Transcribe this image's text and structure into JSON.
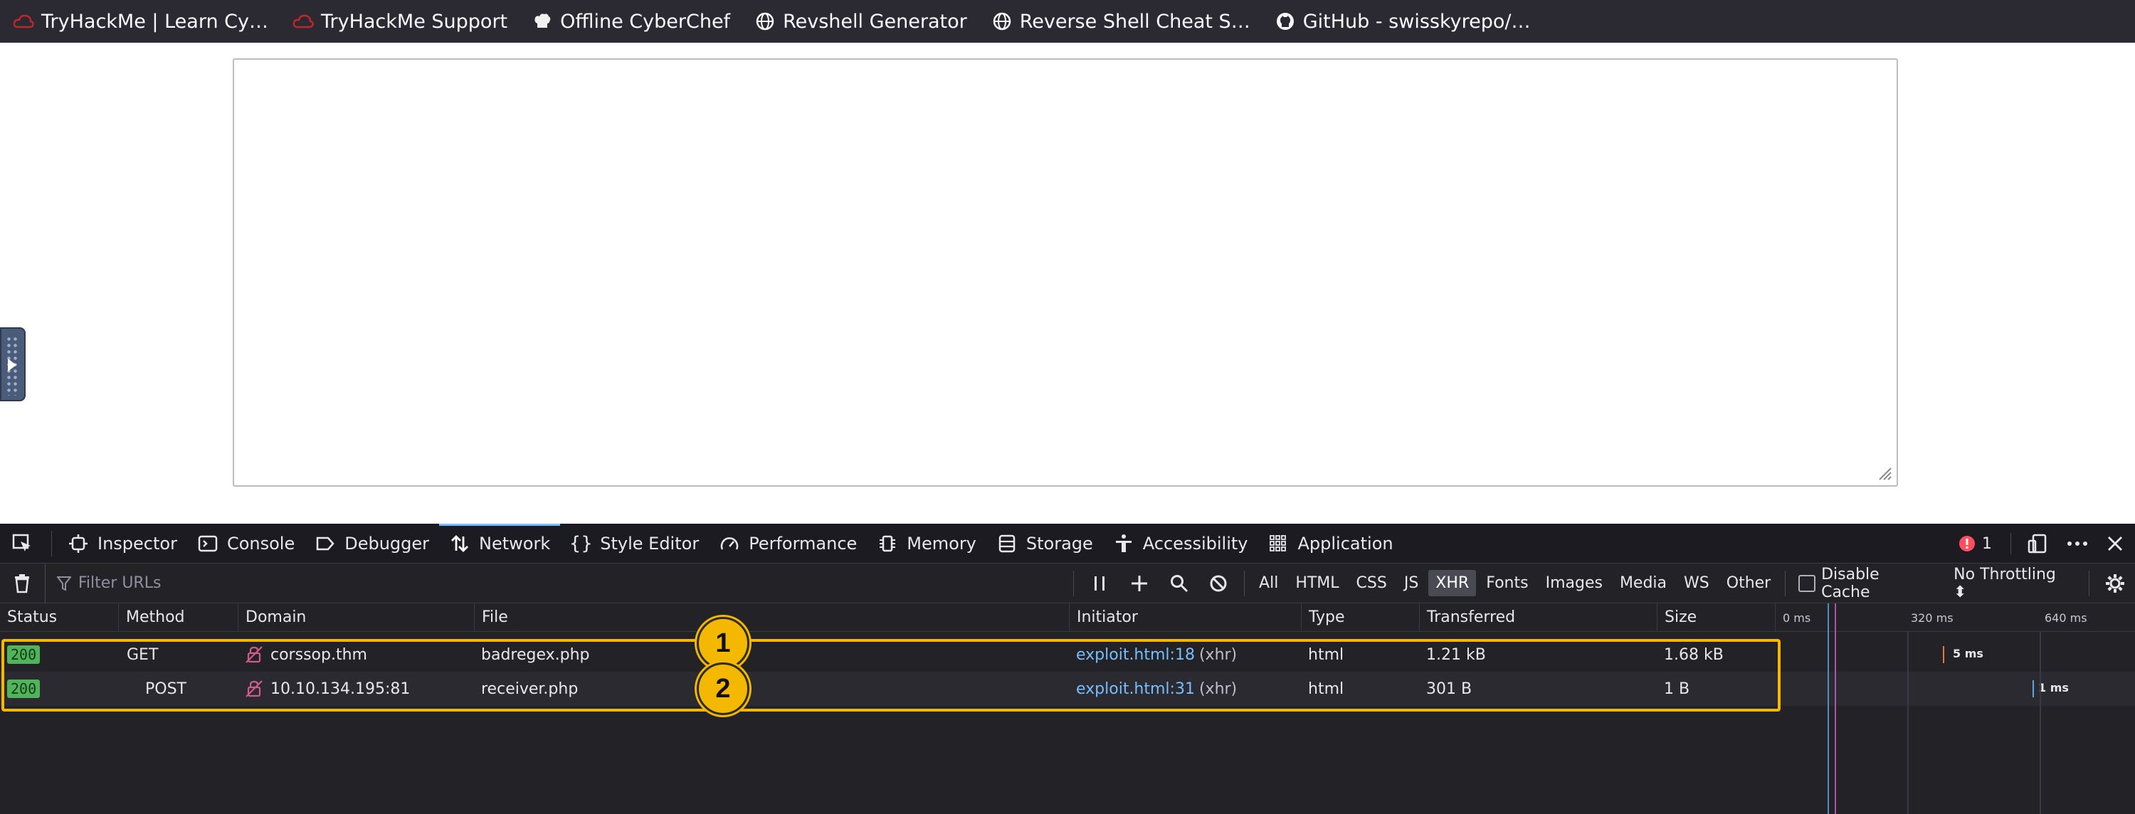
{
  "bookmarks": [
    {
      "label": "TryHackMe | Learn Cy…",
      "icon": "tryhackme-cloud-icon"
    },
    {
      "label": "TryHackMe Support",
      "icon": "tryhackme-cloud-icon"
    },
    {
      "label": "Offline CyberChef",
      "icon": "chef-hat-icon"
    },
    {
      "label": "Revshell Generator",
      "icon": "globe-icon"
    },
    {
      "label": "Reverse Shell Cheat S…",
      "icon": "globe-icon"
    },
    {
      "label": "GitHub - swisskyrepo/…",
      "icon": "github-icon"
    }
  ],
  "devtools": {
    "tabs": [
      "Inspector",
      "Console",
      "Debugger",
      "Network",
      "Style Editor",
      "Performance",
      "Memory",
      "Storage",
      "Accessibility",
      "Application"
    ],
    "active_tab": "Network",
    "error_count": "1",
    "filter_placeholder": "Filter URLs",
    "filter_types": [
      "All",
      "HTML",
      "CSS",
      "JS",
      "XHR",
      "Fonts",
      "Images",
      "Media",
      "WS",
      "Other"
    ],
    "active_filter": "XHR",
    "disable_cache_label": "Disable Cache",
    "throttling": "No Throttling ⬍"
  },
  "network": {
    "columns": [
      "Status",
      "Method",
      "Domain",
      "File",
      "Initiator",
      "Type",
      "Transferred",
      "Size"
    ],
    "timeline_ticks": [
      "0 ms",
      "320 ms",
      "640 ms"
    ],
    "rows": [
      {
        "status": "200",
        "method": "GET",
        "domain": "corssop.thm",
        "file": "badregex.php",
        "initiator_link": "exploit.html:18",
        "initiator_type": "(xhr)",
        "type": "html",
        "transferred": "1.21 kB",
        "size": "1.68 kB",
        "timing": "5 ms"
      },
      {
        "status": "200",
        "method": "POST",
        "domain": "10.10.134.195:81",
        "file": "receiver.php",
        "initiator_link": "exploit.html:31",
        "initiator_type": "(xhr)",
        "type": "html",
        "transferred": "301 B",
        "size": "1 B",
        "timing": "1 ms"
      }
    ]
  },
  "annotations": [
    "1",
    "2"
  ],
  "colors": {
    "highlight": "#f5b800",
    "status_ok": "#51b45a",
    "link": "#75bfff"
  }
}
